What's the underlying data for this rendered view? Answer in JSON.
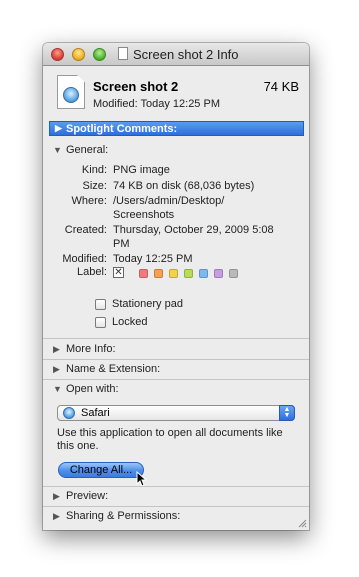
{
  "window": {
    "title": "Screen shot 2 Info"
  },
  "header": {
    "file_name": "Screen shot 2",
    "file_size": "74 KB",
    "modified": "Modified: Today 12:25 PM",
    "icon": "png-file-icon"
  },
  "spotlight": {
    "label": "Spotlight Comments:"
  },
  "general": {
    "label": "General:",
    "kind_label": "Kind:",
    "kind_value": "PNG image",
    "size_label": "Size:",
    "size_value": "74 KB on disk (68,036 bytes)",
    "where_label": "Where:",
    "where_value_1": "/Users/admin/Desktop/",
    "where_value_2": "Screenshots",
    "created_label": "Created:",
    "created_value_1": "Thursday, October 29, 2009 5:08",
    "created_value_2": "PM",
    "modified_label": "Modified:",
    "modified_value": "Today 12:25 PM",
    "label_label": "Label:",
    "label_none": "✕",
    "label_colors": [
      "#f27a7a",
      "#f5a14f",
      "#f3d24a",
      "#b8dc55",
      "#7cb8f2",
      "#c79ce6",
      "#b9b9b9"
    ],
    "stationery_label": "Stationery pad",
    "stationery_checked": false,
    "locked_label": "Locked",
    "locked_checked": false
  },
  "sections": {
    "more_info": "More Info:",
    "name_extension": "Name & Extension:",
    "open_with": "Open with:",
    "preview": "Preview:",
    "sharing": "Sharing & Permissions:"
  },
  "open_with": {
    "app_name": "Safari",
    "app_icon": "safari-compass-icon",
    "description": "Use this application to open all documents like this one.",
    "change_all": "Change All..."
  }
}
